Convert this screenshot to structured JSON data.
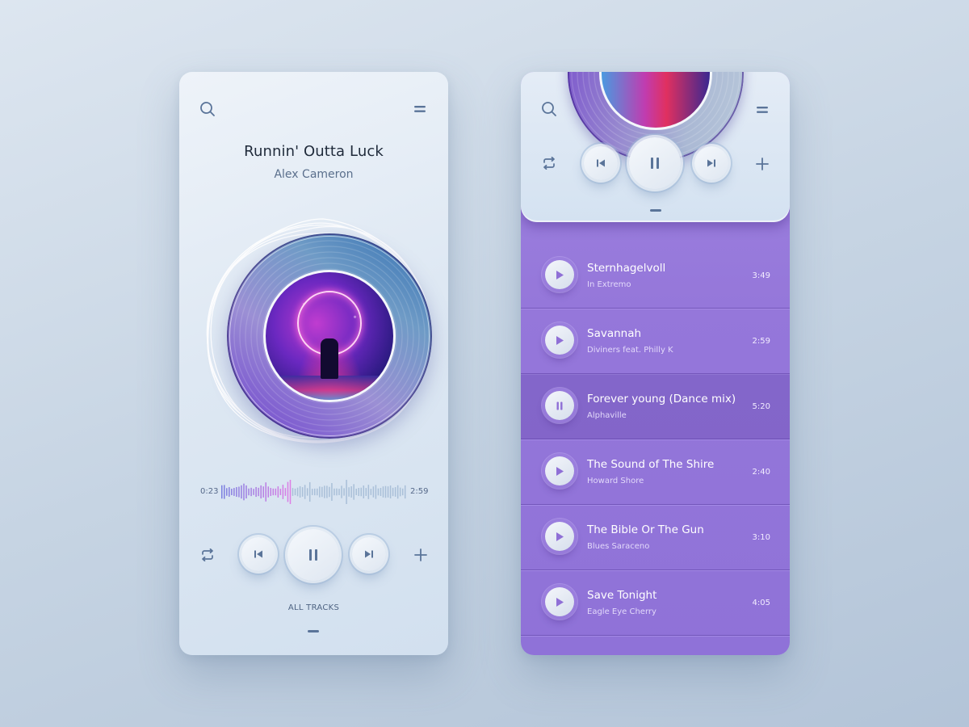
{
  "player": {
    "title": "Runnin' Outta Luck",
    "artist": "Alex Cameron",
    "elapsed": "0:23",
    "duration": "2:59",
    "progress_fraction": 0.38,
    "all_tracks_label": "ALL TRACKS",
    "icons": {
      "search": "search-icon",
      "menu": "menu-icon",
      "repeat": "repeat-icon",
      "previous": "previous-icon",
      "pause": "pause-icon",
      "next": "next-icon",
      "add": "plus-icon"
    }
  },
  "colors": {
    "icon": "#5a7499",
    "accent_purple": "#9577da",
    "waveform_played_start": "#7b7fe0",
    "waveform_played_end": "#e17ee6",
    "waveform_unplayed": "#a9bfd8"
  },
  "playlist": {
    "tracks": [
      {
        "title": "Sternhagelvoll",
        "artist": "In Extremo",
        "duration": "3:49",
        "state": "play"
      },
      {
        "title": "Savannah",
        "artist": "Diviners feat. Philly K",
        "duration": "2:59",
        "state": "play"
      },
      {
        "title": "Forever young (Dance mix)",
        "artist": "Alphaville",
        "duration": "5:20",
        "state": "pause"
      },
      {
        "title": "The Sound of The Shire",
        "artist": "Howard Shore",
        "duration": "2:40",
        "state": "play"
      },
      {
        "title": "The Bible Or The Gun",
        "artist": "Blues Saraceno",
        "duration": "3:10",
        "state": "play"
      },
      {
        "title": "Save Tonight",
        "artist": "Eagle Eye Cherry",
        "duration": "4:05",
        "state": "play"
      }
    ]
  }
}
